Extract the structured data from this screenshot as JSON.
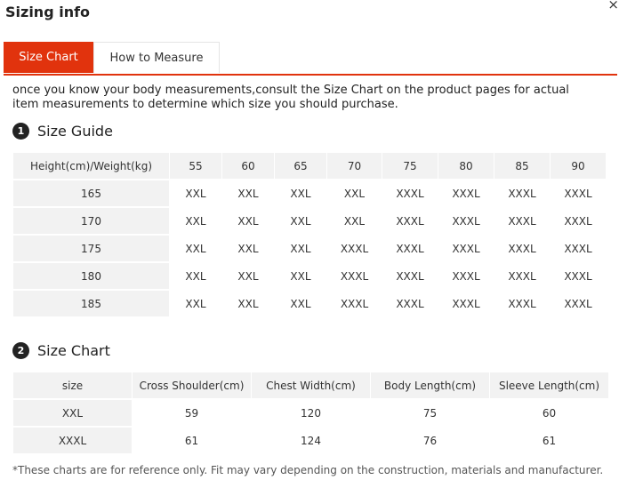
{
  "dialog": {
    "title": "Sizing info",
    "close": "×"
  },
  "tabs": [
    {
      "label": "Size Chart"
    },
    {
      "label": "How to Measure"
    }
  ],
  "intro": "once you know your body measurements,consult the Size Chart on the product pages for actual item measurements to determine which size you should purchase.",
  "guide": {
    "number": "1",
    "title": "Size Guide",
    "corner": "Height(cm)/Weight(kg)",
    "weights": [
      "55",
      "60",
      "65",
      "70",
      "75",
      "80",
      "85",
      "90"
    ],
    "rows": [
      {
        "height": "165",
        "sizes": [
          "XXL",
          "XXL",
          "XXL",
          "XXL",
          "XXXL",
          "XXXL",
          "XXXL",
          "XXXL"
        ]
      },
      {
        "height": "170",
        "sizes": [
          "XXL",
          "XXL",
          "XXL",
          "XXL",
          "XXXL",
          "XXXL",
          "XXXL",
          "XXXL"
        ]
      },
      {
        "height": "175",
        "sizes": [
          "XXL",
          "XXL",
          "XXL",
          "XXXL",
          "XXXL",
          "XXXL",
          "XXXL",
          "XXXL"
        ]
      },
      {
        "height": "180",
        "sizes": [
          "XXL",
          "XXL",
          "XXL",
          "XXXL",
          "XXXL",
          "XXXL",
          "XXXL",
          "XXXL"
        ]
      },
      {
        "height": "185",
        "sizes": [
          "XXL",
          "XXL",
          "XXL",
          "XXXL",
          "XXXL",
          "XXXL",
          "XXXL",
          "XXXL"
        ]
      }
    ]
  },
  "chart": {
    "number": "2",
    "title": "Size Chart",
    "headers": [
      "size",
      "Cross Shoulder(cm)",
      "Chest Width(cm)",
      "Body Length(cm)",
      "Sleeve Length(cm)"
    ],
    "rows": [
      [
        "XXL",
        "59",
        "120",
        "75",
        "60"
      ],
      [
        "XXXL",
        "61",
        "124",
        "76",
        "61"
      ]
    ]
  },
  "footnote": "*These charts are for reference only. Fit may vary depending on the construction, materials and manufacturer."
}
